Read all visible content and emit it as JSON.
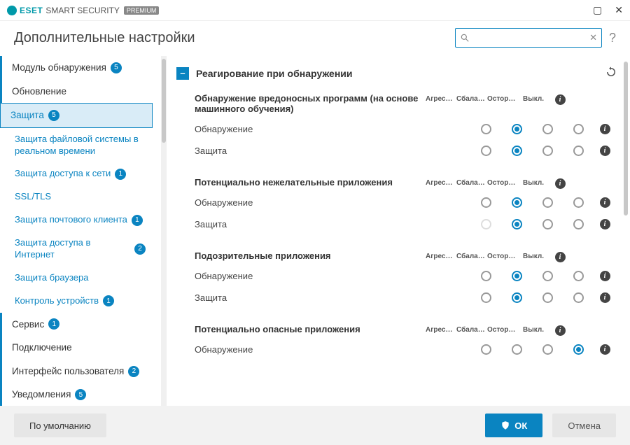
{
  "titlebar": {
    "brand_eset": "ESET",
    "brand_product": "SMART SECURITY",
    "brand_badge": "PREMIUM"
  },
  "header": {
    "title": "Дополнительные настройки",
    "search_placeholder": "",
    "help": "?"
  },
  "sidebar": [
    {
      "label": "Модуль обнаружения",
      "type": "top",
      "badge": "5"
    },
    {
      "label": "Обновление",
      "type": "top"
    },
    {
      "label": "Защита",
      "type": "top",
      "badge": "5",
      "selected": true
    },
    {
      "label": "Защита файловой системы в реальном времени",
      "type": "sub"
    },
    {
      "label": "Защита доступа к сети",
      "type": "sub",
      "badge": "1"
    },
    {
      "label": "SSL/TLS",
      "type": "sub"
    },
    {
      "label": "Защита почтового клиента",
      "type": "sub",
      "badge": "1"
    },
    {
      "label": "Защита доступа в Интернет",
      "type": "sub",
      "badge": "2"
    },
    {
      "label": "Защита браузера",
      "type": "sub"
    },
    {
      "label": "Контроль устройств",
      "type": "sub",
      "badge": "1"
    },
    {
      "label": "Сервис",
      "type": "top",
      "badge": "1"
    },
    {
      "label": "Подключение",
      "type": "top"
    },
    {
      "label": "Интерфейс пользователя",
      "type": "top",
      "badge": "2"
    },
    {
      "label": "Уведомления",
      "type": "top",
      "badge": "5"
    }
  ],
  "panel": {
    "title": "Реагирование при обнаружении",
    "columns": [
      "Агресси...",
      "Сбалан...",
      "Осторо...",
      "Выкл."
    ],
    "sections": [
      {
        "title": "Обнаружение вредоносных программ (на основе машинного обучения)",
        "rows": [
          {
            "name": "Обнаружение",
            "sel": 1,
            "disabled": []
          },
          {
            "name": "Защита",
            "sel": 1,
            "disabled": []
          }
        ]
      },
      {
        "title": "Потенциально нежелательные приложения",
        "rows": [
          {
            "name": "Обнаружение",
            "sel": 1,
            "disabled": []
          },
          {
            "name": "Защита",
            "sel": 1,
            "disabled": [
              0
            ]
          }
        ]
      },
      {
        "title": "Подозрительные приложения",
        "rows": [
          {
            "name": "Обнаружение",
            "sel": 1,
            "disabled": []
          },
          {
            "name": "Защита",
            "sel": 1,
            "disabled": []
          }
        ]
      },
      {
        "title": "Потенциально опасные приложения",
        "rows": [
          {
            "name": "Обнаружение",
            "sel": 3,
            "disabled": []
          }
        ]
      }
    ]
  },
  "footer": {
    "default": "По умолчанию",
    "ok": "ОК",
    "cancel": "Отмена"
  }
}
